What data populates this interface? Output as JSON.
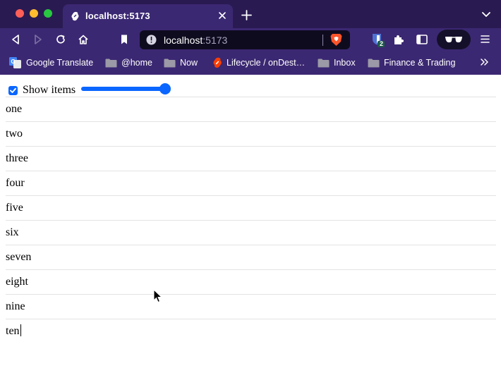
{
  "browser": {
    "tab": {
      "title": "localhost:5173"
    },
    "address": {
      "host": "localhost",
      "port": ":5173"
    },
    "extension_badge": "2",
    "bookmarks": [
      {
        "label": "Google Translate",
        "icon": "google-translate-icon"
      },
      {
        "label": "@home",
        "icon": "folder-icon"
      },
      {
        "label": "Now",
        "icon": "folder-icon"
      },
      {
        "label": "Lifecycle / onDest…",
        "icon": "svelte-icon"
      },
      {
        "label": "Inbox",
        "icon": "folder-icon"
      },
      {
        "label": "Finance & Trading",
        "icon": "folder-icon"
      }
    ]
  },
  "app": {
    "checkbox": {
      "label": "Show items",
      "checked": true
    },
    "slider": {
      "value_fraction": 1.0
    },
    "items": [
      "one",
      "two",
      "three",
      "four",
      "five",
      "six",
      "seven",
      "eight",
      "nine",
      "ten"
    ]
  },
  "colors": {
    "accent": "#0a66ff",
    "chrome": "#3b2872",
    "tabbar": "#2a1a52"
  }
}
